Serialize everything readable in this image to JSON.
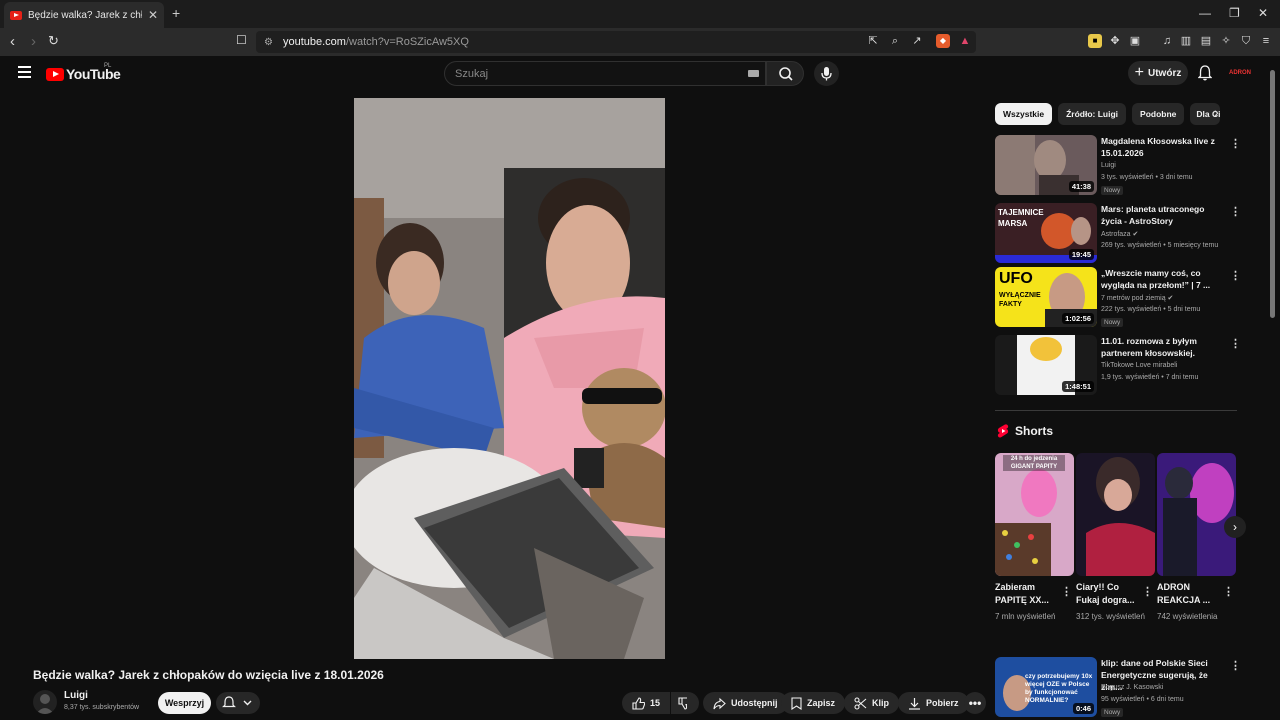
{
  "browser": {
    "tab_title": "Będzie walka? Jarek z chłopaków",
    "new_tab": "+",
    "url_host": "youtube.com",
    "url_path": "/watch?v=RoSZicAw5XQ"
  },
  "header": {
    "logo": "YouTube",
    "country": "PL",
    "search_placeholder": "Szukaj",
    "create_label": "Utwórz",
    "avatar_label": "ADRON"
  },
  "video": {
    "title": "Będzie walka? Jarek z chłopaków do wzięcia live z 18.01.2026",
    "channel": "Luigi",
    "subscribers": "8,37 tys. subskrybentów",
    "support_label": "Wesprzyj",
    "likes": "15",
    "share": "Udostępnij",
    "save": "Zapisz",
    "clip": "Klip",
    "download": "Pobierz"
  },
  "chips": [
    "Wszystkie",
    "Źródło: Luigi",
    "Podobne",
    "Dla Ciebie"
  ],
  "related": [
    {
      "title": "Magdalena Kłosowska live z 15.01.2026",
      "channel": "Luigi",
      "meta": "3 tys. wyświetleń • 3 dni temu",
      "duration": "41:38",
      "badge": "Nowy"
    },
    {
      "title": "Mars: planeta utraconego życia - AstroStory",
      "channel": "Astrofaza",
      "meta": "269 tys. wyświetleń • 5 miesięcy temu",
      "duration": "19:45",
      "thumb_text": "TAJEMNICE MARSA"
    },
    {
      "title": "„Wreszcie mamy coś, co wygląda na przełom!” | 7 ...",
      "channel": "7 metrów pod ziemią",
      "meta": "222 tys. wyświetleń • 5 dni temu",
      "duration": "1:02:56",
      "badge": "Nowy",
      "thumb_text": "UFO",
      "thumb_sub": "WYŁĄCZNIE FAKTY"
    },
    {
      "title": "11.01. rozmowa z byłym partnerem kłosowskiej.",
      "channel": "TikTokowe Love mirabeli",
      "meta": "1,9 tys. wyświetleń • 7 dni temu",
      "duration": "1:48:51"
    },
    {
      "title": "klip: dane od Polskie Sieci Energetyczne sugerują, że zim...",
      "channel": "Bogusz J. Kasowski",
      "meta": "95 wyświetleń • 6 dni temu",
      "duration": "0:46",
      "badge": "Nowy",
      "thumb_text": "czy potrzebujemy 10x więcej OZE w Polsce by funkcjonować NORMALNIE?"
    }
  ],
  "shorts": {
    "header": "Shorts",
    "items": [
      {
        "title": "Zabieram PAPITĘ XX...",
        "views": "7 mln wyświetleń",
        "overlay": "24 h do jedzenia GIGANT PAPITY"
      },
      {
        "title": "Ciary!! Co Fukaj dogra...",
        "views": "312 tys. wyświetleń"
      },
      {
        "title": "ADRON REAKCJA ...",
        "views": "742 wyświetlenia"
      }
    ]
  },
  "colors": {
    "accent": "#ff0000",
    "bg": "#0f0f0f",
    "chip_selected": "#f1f1f1"
  }
}
